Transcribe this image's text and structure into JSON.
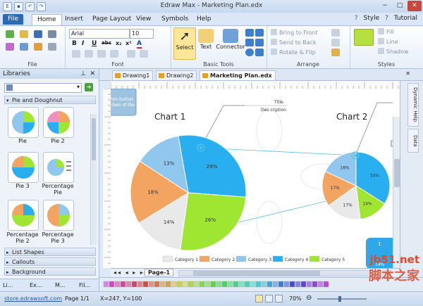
{
  "window": {
    "title": "Edraw Max - Marketing Plan.edx",
    "controls": [
      "−",
      "□",
      "✕"
    ]
  },
  "menu": {
    "tabs": [
      "File",
      "Home",
      "Insert",
      "Page Layout",
      "View",
      "Symbols",
      "Help"
    ],
    "right": [
      "Style",
      "Tutorial"
    ]
  },
  "ribbon": {
    "groups": {
      "file": "File",
      "font": "Font",
      "basic_tools": "Basic Tools",
      "arrange": "Arrange",
      "styles": "Styles"
    },
    "font_name": "Arial",
    "font_size": "10",
    "format_buttons": [
      "B",
      "I",
      "U",
      "abc",
      "x₂",
      "x²",
      "A"
    ],
    "tools": [
      "Select",
      "Text",
      "Connector"
    ],
    "arrange": [
      "Bring to Front",
      "Send to Back",
      "Rotate & Flip"
    ],
    "styles": [
      "Fill",
      "Line",
      "Shadow"
    ]
  },
  "libraries": {
    "title": "Libraries",
    "open_section": "Pie and Doughnut",
    "shapes": [
      "Pie",
      "Pie 2",
      "Pie 3",
      "Percentage Pie",
      "Percentage Pie 2",
      "Percentage Pie 3"
    ],
    "sections": [
      "List Shapes",
      "Callouts",
      "Background"
    ],
    "bottom_tabs": [
      "Li...",
      "Ex...",
      "M...",
      "Fil..."
    ]
  },
  "documents": {
    "tabs": [
      "Drawing1",
      "Drawing2",
      "Marketing Plan.edx"
    ],
    "active": "Marketing Plan.edx"
  },
  "right_panel": {
    "tabs": [
      "Dynamic Help",
      "Data"
    ]
  },
  "canvas": {
    "tooltip": "lon button\nitem of the",
    "callout_title": "Title",
    "callout_description": "Des cription",
    "badge_number": "1",
    "badge_partial": "14%"
  },
  "chart_data": [
    {
      "type": "pie",
      "title": "Chart 1",
      "categories": [
        "Category 1",
        "Category 2",
        "Category 3",
        "Category 4",
        "Category 5"
      ],
      "values": [
        14,
        18,
        13,
        29,
        26
      ],
      "labels": [
        "14%",
        "18%",
        "13%",
        "29%",
        "26%"
      ],
      "legend": "bottom"
    },
    {
      "type": "pie",
      "title": "Chart 2",
      "categories": [
        "Category 1",
        "Category 2",
        "Category 3",
        "Category 4",
        "Category 5"
      ],
      "values": [
        17,
        17,
        18,
        34,
        14
      ],
      "labels": [
        "17%",
        "17%",
        "18%",
        "34%",
        "14%"
      ]
    }
  ],
  "colors": {
    "category_1": "#e9e9ea",
    "category_2": "#f3a460",
    "category_3": "#8fc7ee",
    "category_4": "#29aef0",
    "category_5": "#9ee632"
  },
  "page_bar": {
    "page_tab": "Page-1"
  },
  "status": {
    "url": "store.edrawsoft.com",
    "page": "Page 1/1",
    "coords": "X=247, Y=100",
    "zoom": "70%"
  },
  "watermark": {
    "site": "jb51.net",
    "brand": "脚本之家"
  }
}
